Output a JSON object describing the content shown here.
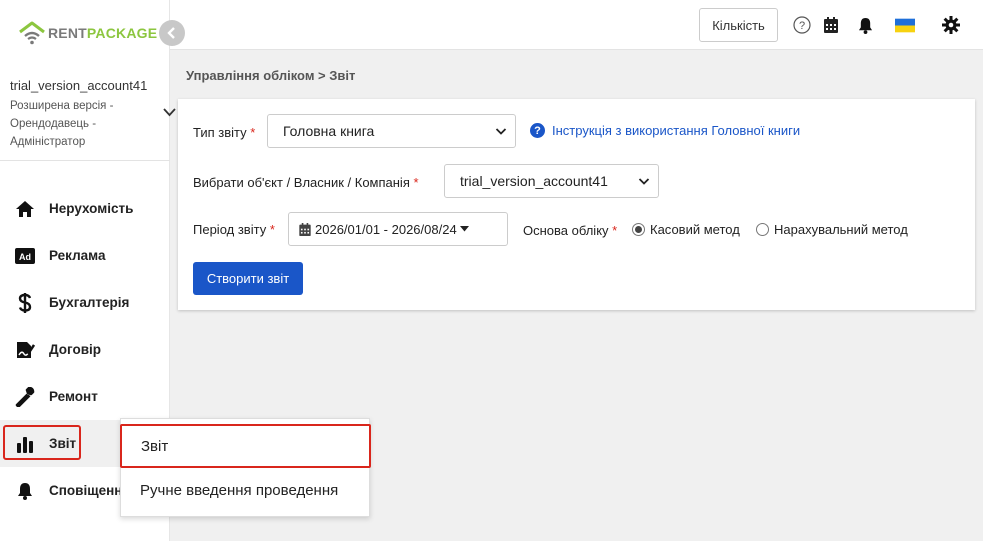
{
  "brand": {
    "part1": "RENT",
    "part2": "PACKAGE",
    "color_primary": "#8cc63f",
    "color_secondary": "#7a7a7a"
  },
  "account": {
    "name": "trial_version_account41",
    "role": "Розширена версія - Орендодавець - Адміністратор"
  },
  "sidebar": {
    "items": [
      {
        "label": "Нерухомість",
        "icon": "home-icon"
      },
      {
        "label": "Реклама",
        "icon": "ad-icon"
      },
      {
        "label": "Бухгалтерія",
        "icon": "dollar-icon"
      },
      {
        "label": "Договір",
        "icon": "contract-icon"
      },
      {
        "label": "Ремонт",
        "icon": "wrench-icon"
      },
      {
        "label": "Звіт",
        "icon": "bar-chart-icon",
        "active": true
      },
      {
        "label": "Сповіщення",
        "icon": "bell-icon"
      }
    ]
  },
  "topbar": {
    "quantity_label": "Кількість",
    "icons": [
      "help-icon",
      "calendar-icon",
      "bell-icon",
      "ukraine-flag-icon",
      "gear-icon"
    ]
  },
  "breadcrumb": "Управління обліком > Звіт",
  "form": {
    "report_type_label": "Тип звіту",
    "report_type_value": "Головна книга",
    "help_link": "Інструкція з використання Головної книги",
    "entity_label": "Вибрати об'єкт / Власник / Компанія",
    "entity_value": "trial_version_account41",
    "period_label": "Період звіту",
    "period_value": "2026/01/01 - 2026/08/24",
    "basis_label": "Основа обліку",
    "basis_options": [
      {
        "label": "Касовий метод",
        "checked": true
      },
      {
        "label": "Нарахувальний метод",
        "checked": false
      }
    ],
    "required_mark": "*",
    "create_button": "Створити звіт"
  },
  "flyout": {
    "items": [
      {
        "label": "Звіт",
        "highlighted": true
      },
      {
        "label": "Ручне введення проведення",
        "highlighted": false
      }
    ]
  },
  "colors": {
    "accent": "#1a56c8",
    "required": "#d9261c",
    "highlight_border": "#d9261c"
  }
}
